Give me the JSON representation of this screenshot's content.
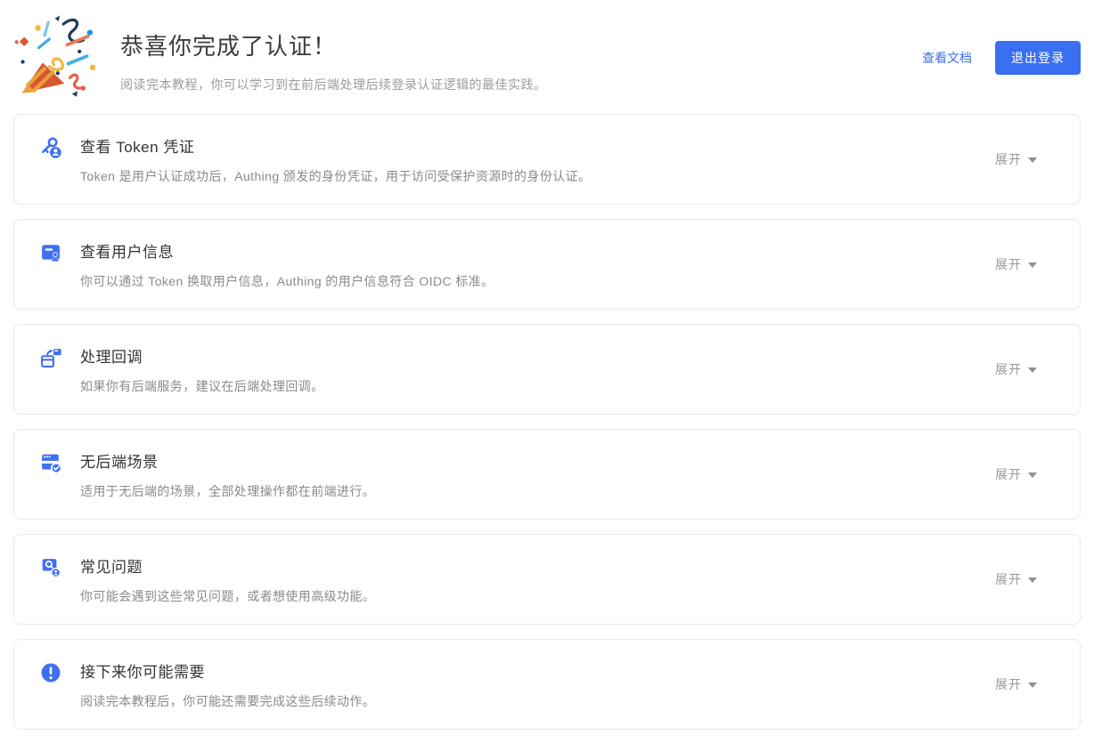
{
  "colors": {
    "brand_blue": "#3a6ff2",
    "card_border": "#e9e9e9",
    "text_primary": "#3c3c3c",
    "text_secondary": "#8a8a8a",
    "expand_gray": "#999999"
  },
  "header": {
    "icon": "party-popper-icon",
    "title": "恭喜你完成了认证！",
    "subtitle": "阅读完本教程，你可以学习到在前后端处理后续登录认证逻辑的最佳实践。",
    "docs_link_label": "查看文档",
    "logout_button_label": "退出登录"
  },
  "cards": [
    {
      "icon": "token-key-user-icon",
      "title": "查看 Token 凭证",
      "description": "Token 是用户认证成功后，Authing 颁发的身份凭证，用于访问受保护资源时的身份认证。",
      "expand_label": "展开"
    },
    {
      "icon": "user-info-card-icon",
      "title": "查看用户信息",
      "description": "你可以通过 Token 换取用户信息，Authing 的用户信息符合 OIDC 标准。",
      "expand_label": "展开"
    },
    {
      "icon": "callback-windows-icon",
      "title": "处理回调",
      "description": "如果你有后端服务，建议在后端处理回调。",
      "expand_label": "展开"
    },
    {
      "icon": "browser-check-icon",
      "title": "无后端场景",
      "description": "适用于无后端的场景，全部处理操作都在前端进行。",
      "expand_label": "展开"
    },
    {
      "icon": "qa-bubble-icon",
      "title": "常见问题",
      "description": "你可能会遇到这些常见问题，或者想使用高级功能。",
      "expand_label": "展开"
    },
    {
      "icon": "exclamation-circle-icon",
      "title": "接下来你可能需要",
      "description": "阅读完本教程后，你可能还需要完成这些后续动作。",
      "expand_label": "展开"
    }
  ]
}
